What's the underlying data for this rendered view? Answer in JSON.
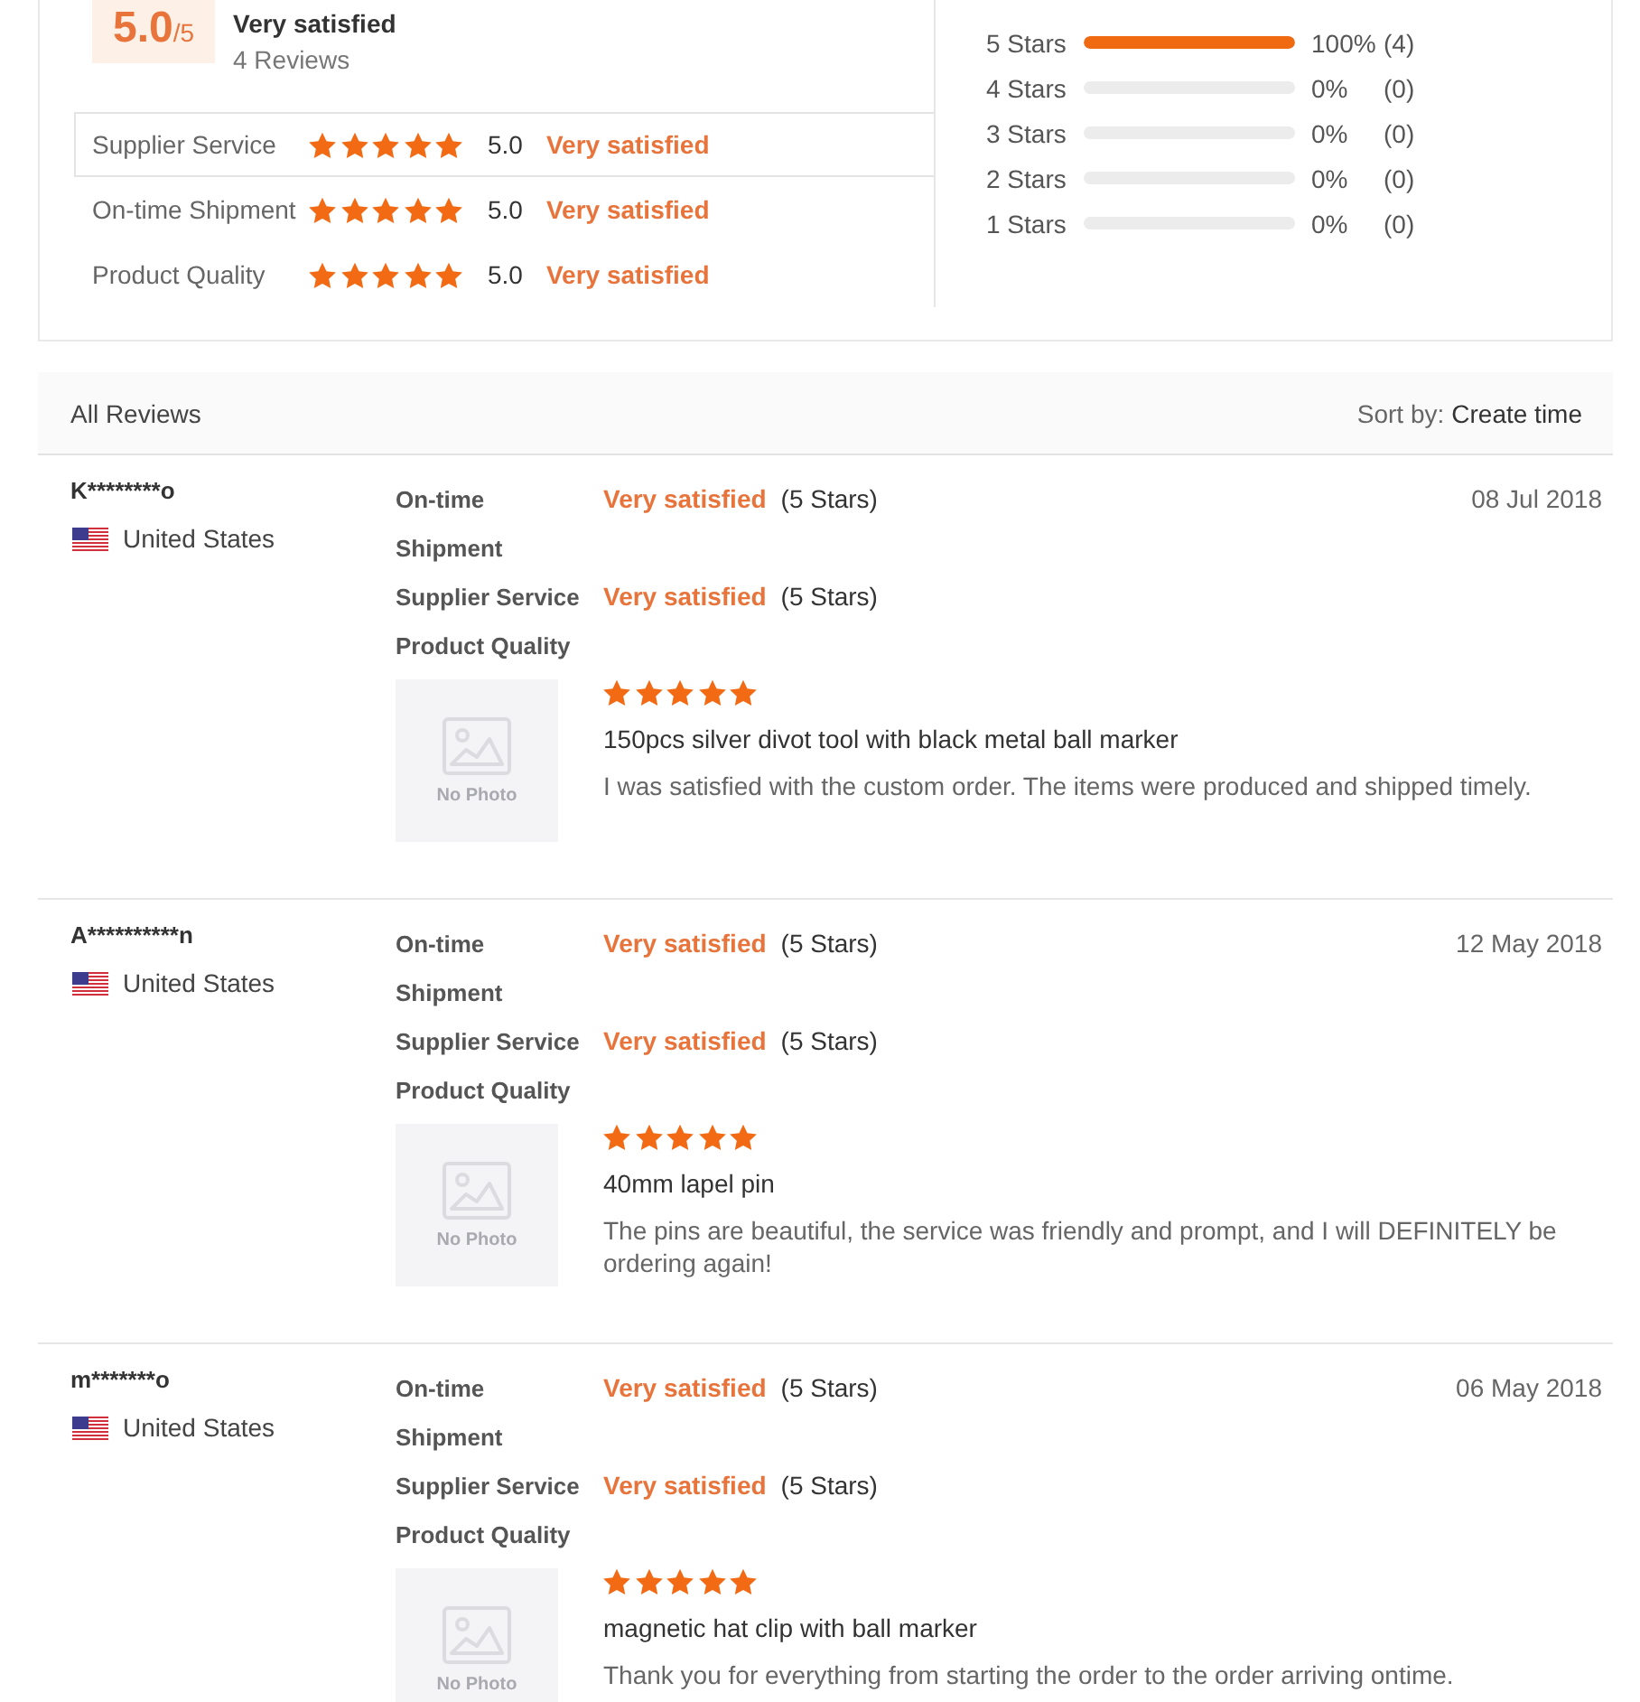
{
  "summary": {
    "score": "5.0",
    "scale": "/5",
    "verdict": "Very satisfied",
    "review_count": "4 Reviews",
    "aspects": [
      {
        "label": "Supplier Service",
        "highlighted": true,
        "stars": 5,
        "score": "5.0",
        "verdict": "Very satisfied"
      },
      {
        "label": "On-time Shipment",
        "highlighted": false,
        "stars": 5,
        "score": "5.0",
        "verdict": "Very satisfied"
      },
      {
        "label": "Product Quality",
        "highlighted": false,
        "stars": 5,
        "score": "5.0",
        "verdict": "Very satisfied"
      }
    ],
    "distribution": [
      {
        "label": "5 Stars",
        "level": 1,
        "percent": "100%",
        "count": "(4)"
      },
      {
        "label": "4 Stars",
        "level": 0,
        "percent": "0%",
        "count": "(0)"
      },
      {
        "label": "3 Stars",
        "level": 0,
        "percent": "0%",
        "count": "(0)"
      },
      {
        "label": "2 Stars",
        "level": 0,
        "percent": "0%",
        "count": "(0)"
      },
      {
        "label": "1 Stars",
        "level": 0,
        "percent": "0%",
        "count": "(0)"
      }
    ]
  },
  "reviews_header": {
    "title": "All Reviews",
    "sort_label": "Sort by:",
    "sort_value": "Create time"
  },
  "reviews": [
    {
      "user": "K********o",
      "country": "United States",
      "date": "08 Jul 2018",
      "ratings": [
        {
          "label": "On-time Shipment",
          "verdict": "Very satisfied",
          "stars_text": "(5 Stars)"
        },
        {
          "label": "Supplier Service",
          "verdict": "Very satisfied",
          "stars_text": "(5 Stars)"
        },
        {
          "label": "Product Quality"
        }
      ],
      "photo_caption": "No Photo",
      "stars": 5,
      "product": "150pcs silver divot tool with black metal ball marker",
      "comment": "I was satisfied with the custom order. The items were produced and shipped timely."
    },
    {
      "user": "A**********n",
      "country": "United States",
      "date": "12 May 2018",
      "ratings": [
        {
          "label": "On-time Shipment",
          "verdict": "Very satisfied",
          "stars_text": "(5 Stars)"
        },
        {
          "label": "Supplier Service",
          "verdict": "Very satisfied",
          "stars_text": "(5 Stars)"
        },
        {
          "label": "Product Quality"
        }
      ],
      "photo_caption": "No Photo",
      "stars": 5,
      "product": "40mm lapel pin",
      "comment": "The pins are beautiful, the service was friendly and prompt, and I will DEFINITELY be ordering again!"
    },
    {
      "user": "m*******o",
      "country": "United States",
      "date": "06 May 2018",
      "ratings": [
        {
          "label": "On-time Shipment",
          "verdict": "Very satisfied",
          "stars_text": "(5 Stars)"
        },
        {
          "label": "Supplier Service",
          "verdict": "Very satisfied",
          "stars_text": "(5 Stars)"
        },
        {
          "label": "Product Quality"
        }
      ],
      "photo_caption": "No Photo",
      "stars": 5,
      "product": "magnetic hat clip with ball marker",
      "comment": "Thank you for everything from starting the order to the order arriving ontime."
    }
  ]
}
